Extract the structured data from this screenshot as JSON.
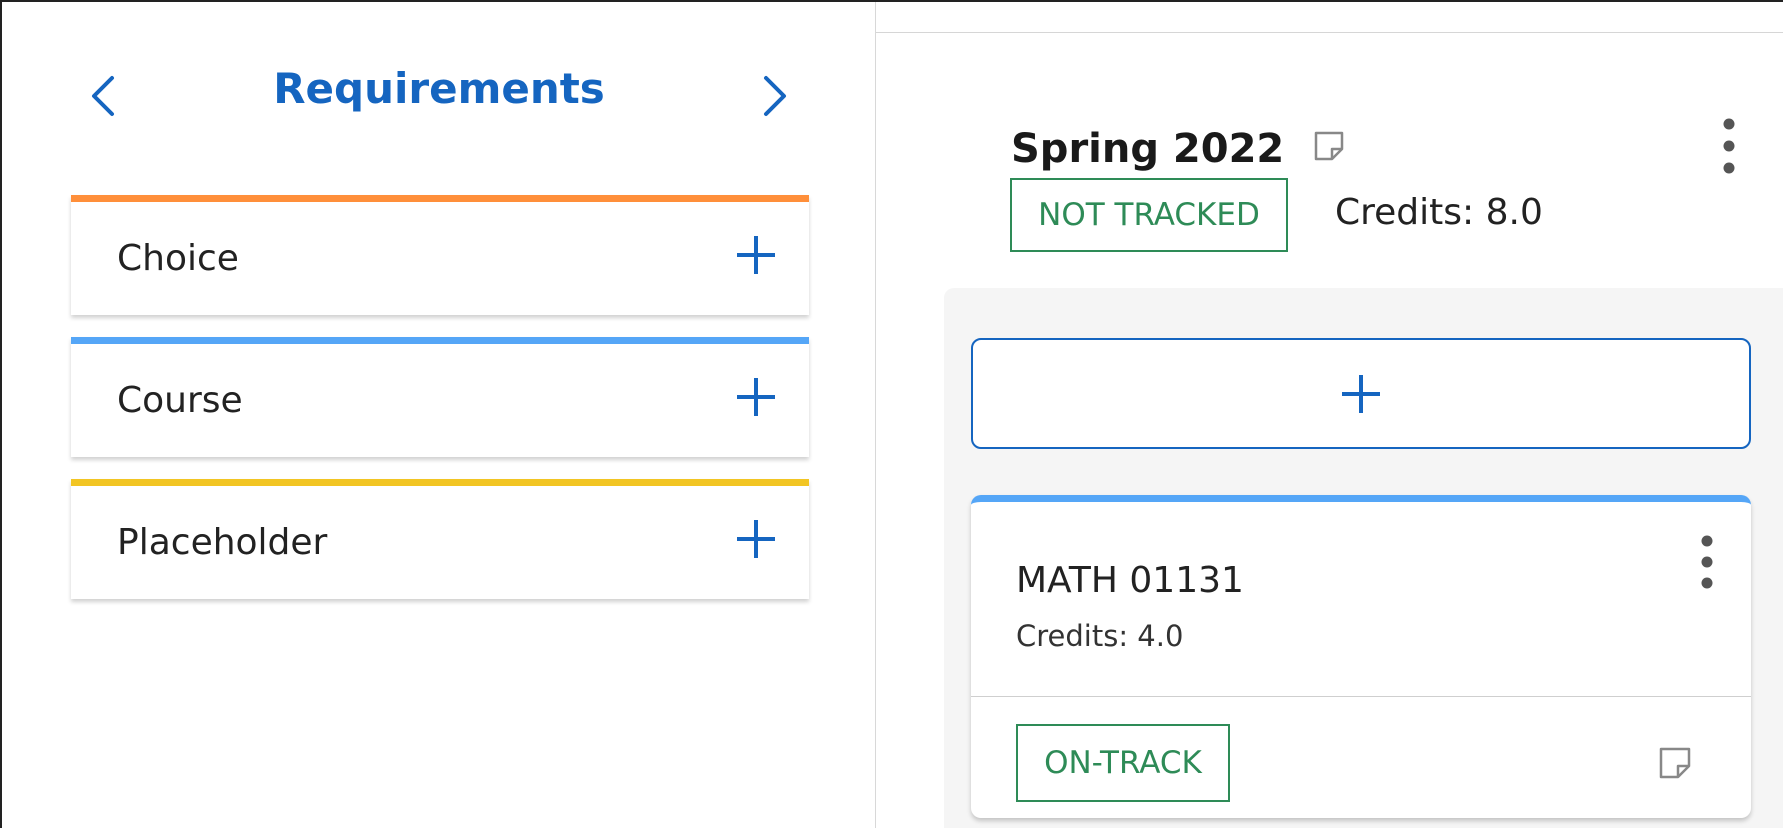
{
  "requirements": {
    "title": "Requirements",
    "prev_icon": "chevron-left-icon",
    "next_icon": "chevron-right-icon",
    "items": [
      {
        "label": "Choice",
        "accent": "#ff8f3a",
        "icon": "plus-icon"
      },
      {
        "label": "Course",
        "accent": "#55a6f7",
        "icon": "plus-icon"
      },
      {
        "label": "Placeholder",
        "accent": "#f2c523",
        "icon": "plus-icon"
      }
    ]
  },
  "term": {
    "title": "Spring 2022",
    "note_icon": "note-icon",
    "menu_icon": "more-vertical-icon",
    "status": "NOT TRACKED",
    "credits": "Credits:  8.0",
    "add_icon": "plus-icon",
    "courses": [
      {
        "code": "MATH 01131",
        "credits": "Credits: 4.0",
        "status": "ON-TRACK",
        "accent": "#55a6f7",
        "menu_icon": "more-vertical-icon",
        "note_icon": "note-icon"
      }
    ]
  },
  "colors": {
    "brand_blue": "#1565c0",
    "status_green": "#2e8b57",
    "panel_bg": "#f5f5f5"
  }
}
